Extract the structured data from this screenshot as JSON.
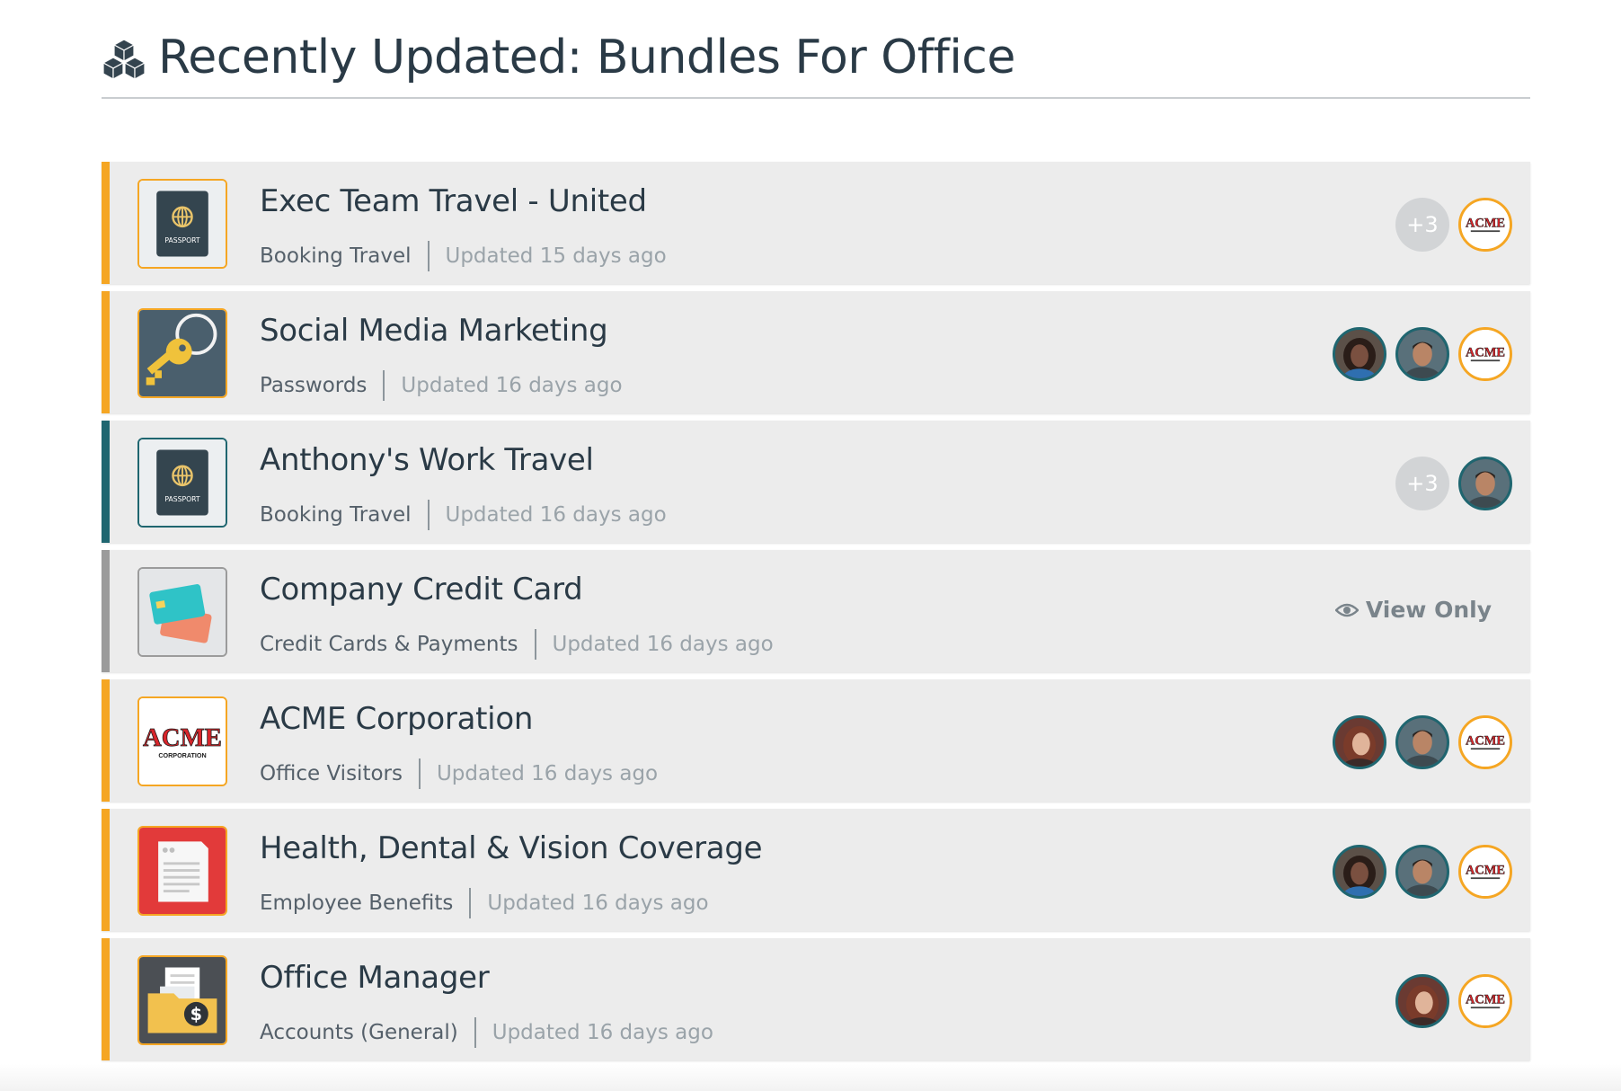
{
  "header": {
    "icon": "cubes-icon",
    "title": "Recently Updated: Bundles For Office"
  },
  "colors": {
    "orange": "#f5a623",
    "teal": "#1f6670",
    "gray": "#9b9b9b"
  },
  "bundles": [
    {
      "title": "Exec Team Travel - United",
      "category": "Booking Travel",
      "updated": "Updated  15 days ago",
      "accent": "orange",
      "thumbnail": "passport",
      "passport_text": "PASSPORT",
      "sharing": [
        "+3",
        "acme-logo"
      ]
    },
    {
      "title": "Social Media Marketing",
      "category": "Passwords",
      "updated": "Updated  16 days ago",
      "accent": "orange",
      "thumbnail": "key",
      "sharing": [
        "person-woman-1",
        "person-man",
        "acme-logo"
      ]
    },
    {
      "title": "Anthony's Work Travel",
      "category": "Booking Travel",
      "updated": "Updated  16 days ago",
      "accent": "teal",
      "thumbnail": "passport",
      "passport_text": "PASSPORT",
      "sharing": [
        "+3",
        "person-man"
      ]
    },
    {
      "title": "Company Credit Card",
      "category": "Credit Cards & Payments",
      "updated": "Updated  16 days ago",
      "accent": "gray",
      "thumbnail": "credit-card",
      "view_only": "View Only"
    },
    {
      "title": "ACME Corporation",
      "category": "Office Visitors",
      "updated": "Updated  16 days ago",
      "accent": "orange",
      "thumbnail": "acme",
      "acme_text": "ACME",
      "acme_sub": "CORPORATION",
      "sharing": [
        "person-woman-2",
        "person-man",
        "acme-logo"
      ]
    },
    {
      "title": "Health, Dental & Vision Coverage",
      "category": "Employee Benefits",
      "updated": "Updated  16 days ago",
      "accent": "orange",
      "thumbnail": "document",
      "sharing": [
        "person-woman-1",
        "person-man",
        "acme-logo"
      ]
    },
    {
      "title": "Office Manager",
      "category": "Accounts (General)",
      "updated": "Updated  16 days ago",
      "accent": "orange",
      "thumbnail": "money-folder",
      "sharing": [
        "person-woman-2",
        "acme-logo"
      ]
    }
  ]
}
